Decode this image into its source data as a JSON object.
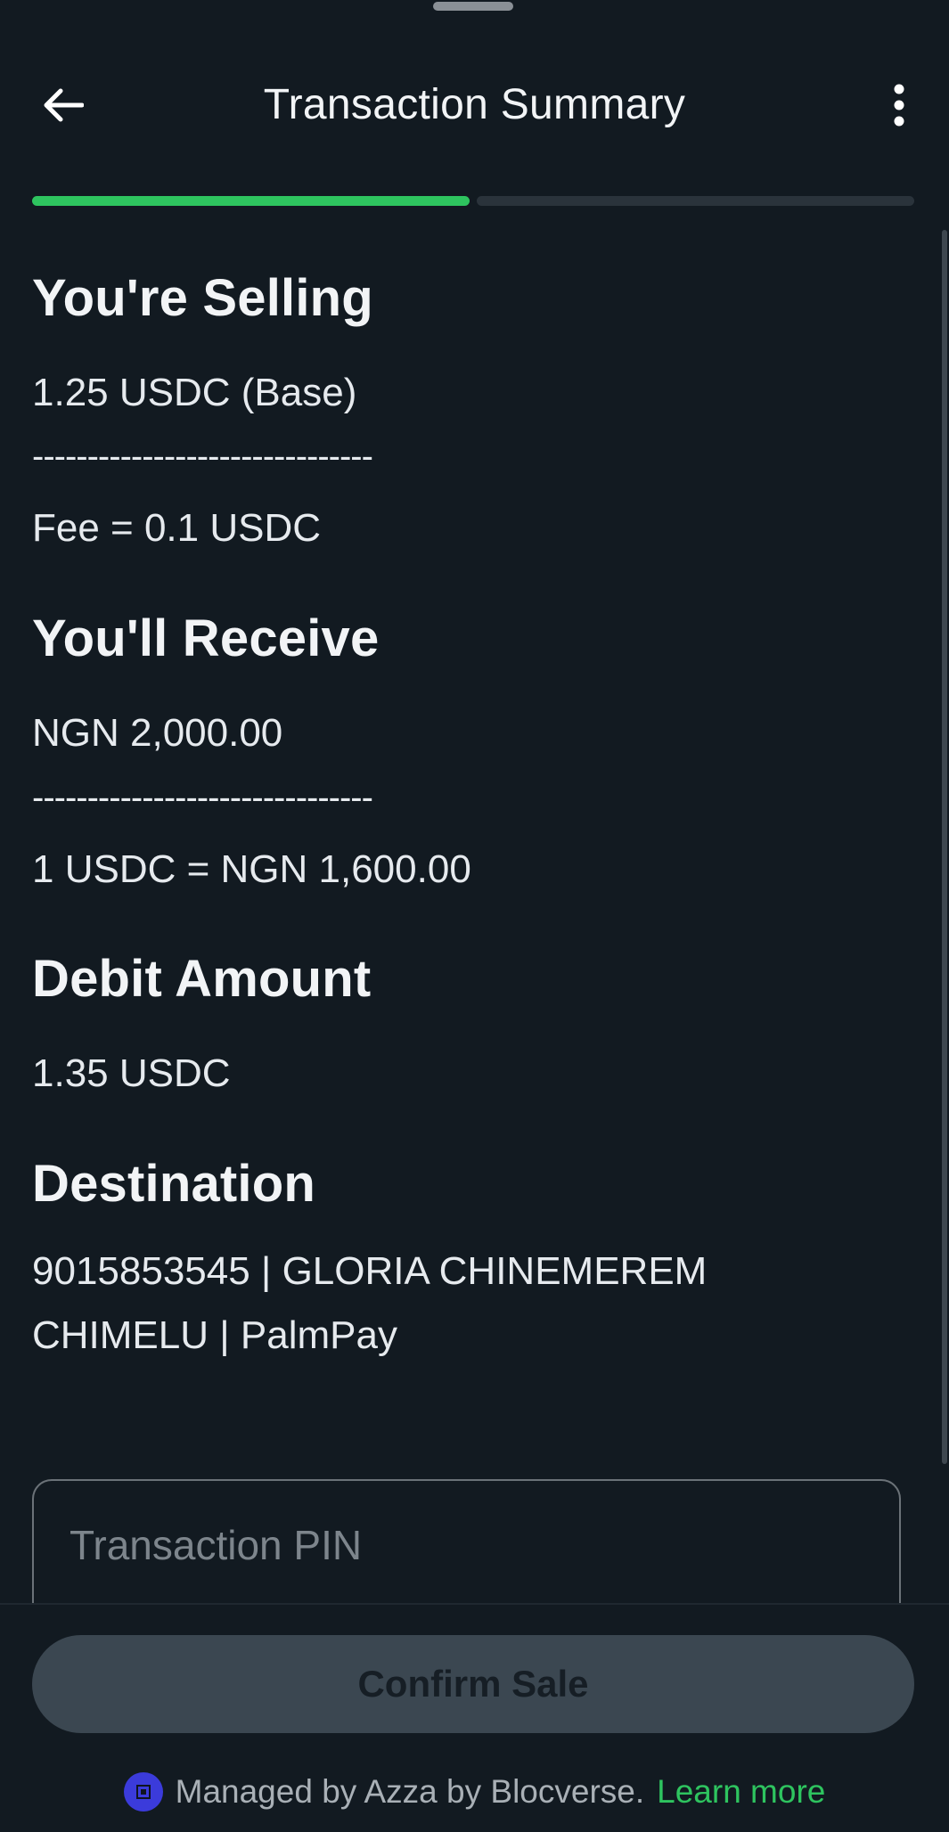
{
  "header": {
    "title": "Transaction Summary"
  },
  "progress": {
    "steps_total": 2,
    "steps_completed": 1
  },
  "sections": {
    "selling": {
      "heading": "You're Selling",
      "amount": "1.25 USDC (Base)",
      "divider": "-------------------------------",
      "fee": "Fee = 0.1 USDC"
    },
    "receive": {
      "heading": "You'll Receive",
      "amount": "NGN 2,000.00",
      "divider": "-------------------------------",
      "rate": "1 USDC = NGN 1,600.00"
    },
    "debit": {
      "heading": "Debit Amount",
      "amount": "1.35 USDC"
    },
    "destination": {
      "heading": "Destination",
      "line1": "9015853545 | GLORIA CHINEMEREM",
      "line2": "CHIMELU | PalmPay"
    }
  },
  "pin": {
    "placeholder": "Transaction PIN",
    "value": ""
  },
  "footer": {
    "confirm_label": "Confirm Sale",
    "managed_text": "Managed by Azza by Blocverse.",
    "learn_more": "Learn more"
  },
  "colors": {
    "background": "#121a21",
    "accent": "#2ec45f",
    "button_disabled": "#3b4751",
    "logo": "#3b3bdb"
  },
  "icons": {
    "back": "arrow-left-icon",
    "menu": "more-vertical-icon",
    "logo": "azza-logo-icon"
  }
}
